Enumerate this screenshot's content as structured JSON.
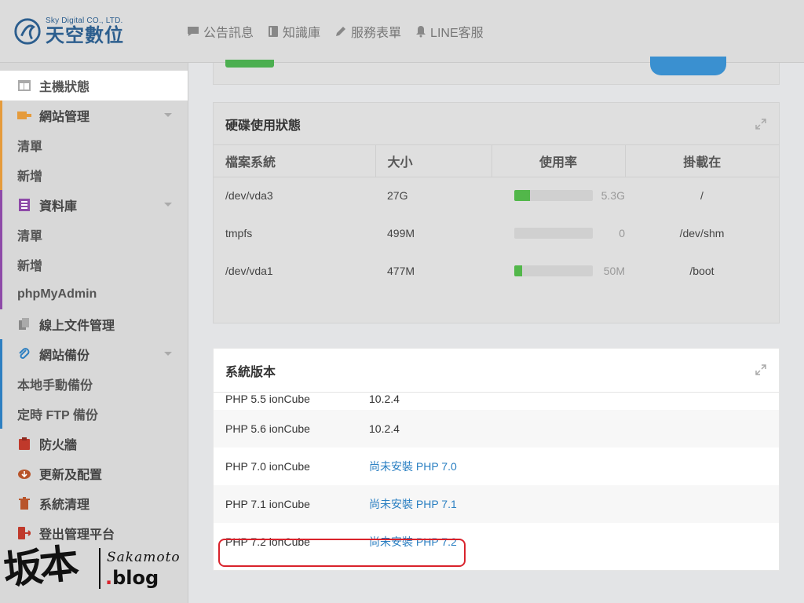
{
  "brand": {
    "name_en": "Sky Digital CO., LTD.",
    "name_zh": "天空數位"
  },
  "topnav": [
    {
      "label": "公告訊息",
      "icon": "chat-icon"
    },
    {
      "label": "知識庫",
      "icon": "book-icon"
    },
    {
      "label": "服務表單",
      "icon": "pencil-icon"
    },
    {
      "label": "LINE客服",
      "icon": "bell-icon"
    }
  ],
  "sidebar": {
    "items": [
      {
        "label": "主機狀態",
        "icon": "dashboard-icon"
      },
      {
        "label": "網站管理",
        "icon": "website-icon",
        "sub": [
          "清單",
          "新增"
        ]
      },
      {
        "label": "資料庫",
        "icon": "database-icon",
        "sub": [
          "清單",
          "新增",
          "phpMyAdmin"
        ]
      },
      {
        "label": "線上文件管理",
        "icon": "files-icon"
      },
      {
        "label": "網站備份",
        "icon": "paperclip-icon",
        "sub": [
          "本地手動備份",
          "定時 FTP 備份"
        ]
      },
      {
        "label": "防火牆",
        "icon": "clipboard-icon"
      },
      {
        "label": "更新及配置",
        "icon": "cloud-download-icon"
      },
      {
        "label": "系統清理",
        "icon": "trash-icon"
      },
      {
        "label": "登出管理平台",
        "icon": "logout-icon"
      }
    ]
  },
  "disk_panel": {
    "title": "硬碟使用狀態",
    "columns": [
      "檔案系統",
      "大小",
      "使用率",
      "掛載在"
    ],
    "rows": [
      {
        "fs": "/dev/vda3",
        "size": "27G",
        "used": "5.3G",
        "fill": 0.2,
        "mount": "/"
      },
      {
        "fs": "tmpfs",
        "size": "499M",
        "used": "0",
        "fill": 0.0,
        "mount": "/dev/shm"
      },
      {
        "fs": "/dev/vda1",
        "size": "477M",
        "used": "50M",
        "fill": 0.1,
        "mount": "/boot"
      }
    ]
  },
  "system_panel": {
    "title": "系統版本",
    "rows": [
      {
        "key": "PHP 5.5 ionCube",
        "value": "10.2.4",
        "link": false
      },
      {
        "key": "PHP 5.6 ionCube",
        "value": "10.2.4",
        "link": false
      },
      {
        "key": "PHP 7.0 ionCube",
        "value": "尚未安裝 PHP 7.0",
        "link": true
      },
      {
        "key": "PHP 7.1 ionCube",
        "value": "尚未安裝 PHP 7.1",
        "link": true
      },
      {
        "key": "PHP 7.2 ionCube",
        "value": "尚未安裝 PHP 7.2",
        "link": true
      }
    ]
  },
  "watermark": {
    "cjk": "坂本",
    "en": "Sakamoto",
    "blog_dot": ".",
    "blog": "blog"
  },
  "colors": {
    "accent_blue": "#2a7fc2",
    "bar_green": "#52b74a",
    "highlight_red": "#d9232c",
    "brand_blue": "#2c5e8e"
  }
}
